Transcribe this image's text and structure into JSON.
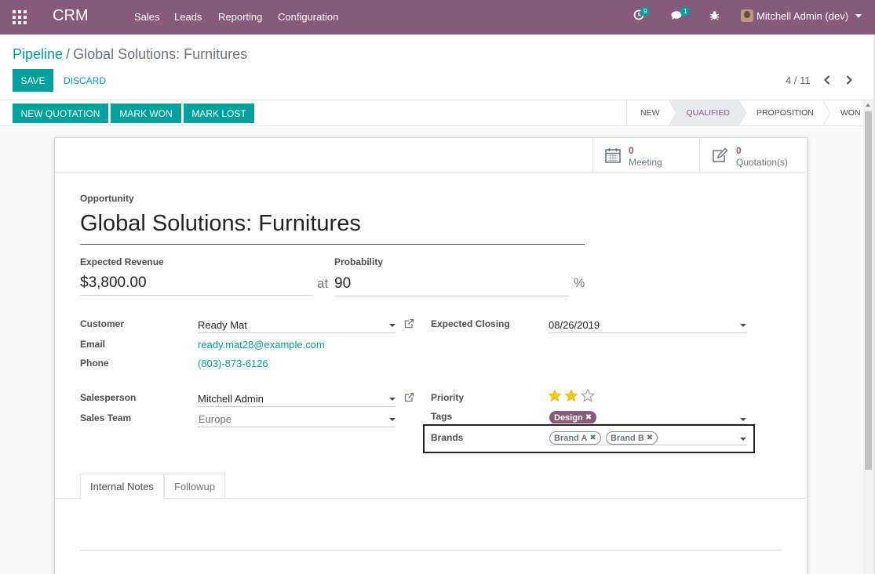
{
  "navbar": {
    "brand": "CRM",
    "menu": [
      "Sales",
      "Leads",
      "Reporting",
      "Configuration"
    ],
    "activity_count": "9",
    "message_count": "1",
    "user": "Mitchell Admin (dev)",
    "bg_color": "#875a7b"
  },
  "breadcrumb": {
    "parent": "Pipeline",
    "separator": "/",
    "current": "Global Solutions: Furnitures"
  },
  "actions": {
    "save": "SAVE",
    "discard": "DISCARD"
  },
  "pager": {
    "value": "4 / 11"
  },
  "statusbar": {
    "buttons": [
      "NEW QUOTATION",
      "MARK WON",
      "MARK LOST"
    ],
    "stages": [
      "NEW",
      "QUALIFIED",
      "PROPOSITION",
      "WON"
    ],
    "active_stage": "QUALIFIED"
  },
  "smart_buttons": {
    "meeting": {
      "count": "0",
      "label": "Meeting",
      "icon": "calendar-icon"
    },
    "quotation": {
      "count": "0",
      "label": "Quotation(s)",
      "icon": "edit-icon"
    }
  },
  "form": {
    "opportunity_label": "Opportunity",
    "name": "Global Solutions: Furnitures",
    "expected_revenue_label": "Expected Revenue",
    "expected_revenue": "$3,800.00",
    "at": "at",
    "probability_label": "Probability",
    "probability": "90",
    "percent": "%",
    "customer_label": "Customer",
    "customer": "Ready Mat",
    "email_label": "Email",
    "email": "ready.mat28@example.com",
    "phone_label": "Phone",
    "phone": "(803)-873-6126",
    "expected_closing_label": "Expected Closing",
    "expected_closing": "08/26/2019",
    "salesperson_label": "Salesperson",
    "salesperson": "Mitchell Admin",
    "sales_team_label": "Sales Team",
    "sales_team": "Europe",
    "priority_label": "Priority",
    "priority_stars": 2,
    "priority_max": 3,
    "tags_label": "Tags",
    "tags": [
      "Design"
    ],
    "brands_label": "Brands",
    "brands": [
      "Brand A",
      "Brand B"
    ]
  },
  "tabs": [
    "Internal Notes",
    "Followup"
  ],
  "colors": {
    "accent": "#00a09d",
    "brand": "#875a7b",
    "star": "#f3cc00"
  }
}
